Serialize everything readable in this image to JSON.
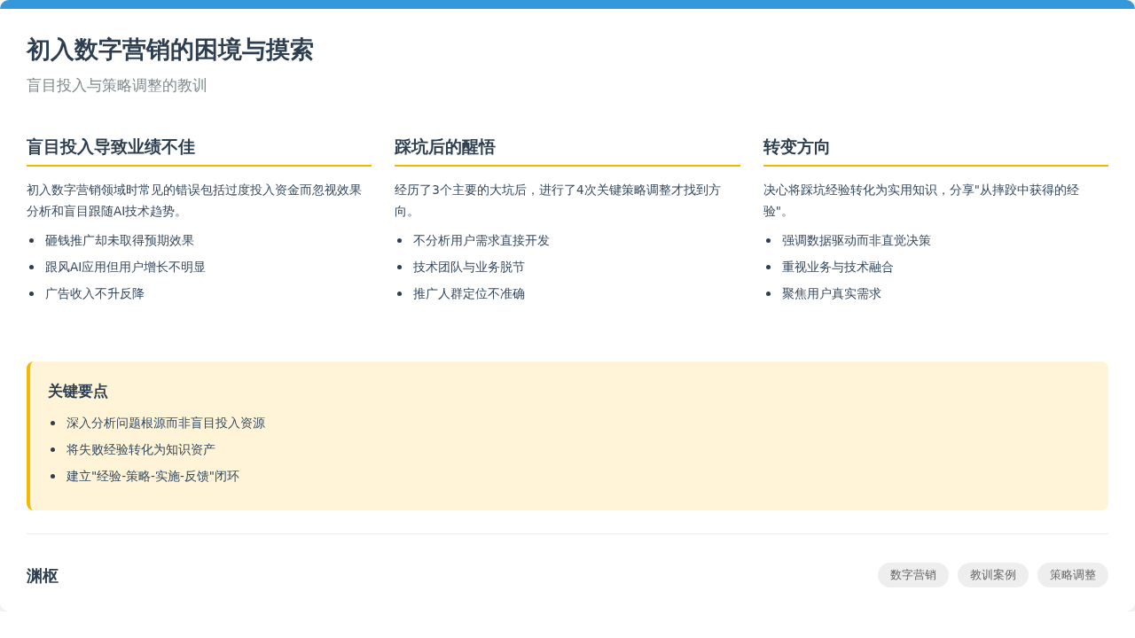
{
  "header": {
    "title": "初入数字营销的困境与摸索",
    "subtitle": "盲目投入与策略调整的教训"
  },
  "columns": [
    {
      "heading": "盲目投入导致业绩不佳",
      "text": "初入数字营销领域时常见的错误包括过度投入资金而忽视效果分析和盲目跟随AI技术趋势。",
      "bullets": [
        "砸钱推广却未取得预期效果",
        "跟风AI应用但用户增长不明显",
        "广告收入不升反降"
      ]
    },
    {
      "heading": "踩坑后的醒悟",
      "text": "经历了3个主要的大坑后，进行了4次关键策略调整才找到方向。",
      "bullets": [
        "不分析用户需求直接开发",
        "技术团队与业务脱节",
        "推广人群定位不准确"
      ]
    },
    {
      "heading": "转变方向",
      "text": "决心将踩坑经验转化为实用知识，分享\"从摔跤中获得的经验\"。",
      "bullets": [
        "强调数据驱动而非直觉决策",
        "重视业务与技术融合",
        "聚焦用户真实需求"
      ]
    }
  ],
  "key_points": {
    "title": "关键要点",
    "bullets": [
      "深入分析问题根源而非盲目投入资源",
      "将失败经验转化为知识资产",
      "建立\"经验-策略-实施-反馈\"闭环"
    ]
  },
  "footer": {
    "brand": "渊枢",
    "tags": [
      "数字营销",
      "教训案例",
      "策略调整"
    ]
  }
}
